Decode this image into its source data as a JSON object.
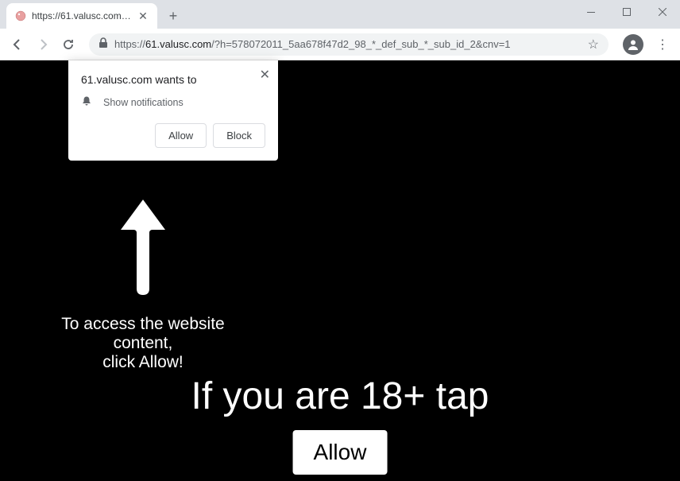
{
  "window": {
    "tab_title": "https://61.valusc.com/?h=57807..."
  },
  "url": {
    "prefix": "https://",
    "domain": "61.valusc.com",
    "path": "/?h=578072011_5aa678f47d2_98_*_def_sub_*_sub_id_2&cnv=1"
  },
  "notification": {
    "title": "61.valusc.com wants to",
    "message": "Show notifications",
    "allow_label": "Allow",
    "block_label": "Block"
  },
  "page": {
    "instruction_line1": "To access the website content,",
    "instruction_line2": "click Allow!",
    "age_text": "If you are 18+ tap",
    "allow_button": "Allow"
  }
}
